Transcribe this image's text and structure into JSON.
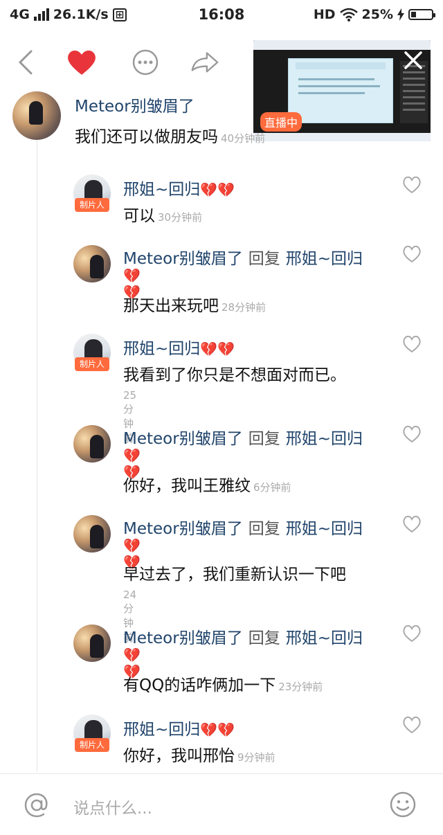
{
  "status_bar": {
    "network": "4G",
    "speed": "26.1K/s",
    "time": "16:08",
    "hd": "HD",
    "battery": "25%"
  },
  "top_nav": {
    "icons": [
      "back-icon",
      "heart-icon",
      "more-icon",
      "share-icon"
    ]
  },
  "pip": {
    "live_label": "直播中"
  },
  "main_comment": {
    "author": "Meteor别皱眉了",
    "text": "我们还可以做朋友吗",
    "time": "40分钟前"
  },
  "replies": [
    {
      "author": "邢姐~回归",
      "hearts": "💔💔",
      "badge": "制片人",
      "text": "可以",
      "time": "30分钟前"
    },
    {
      "author": "Meteor别皱眉了",
      "reply_word": "回复",
      "reply_to": "邢姐~回归",
      "hearts": "💔💔",
      "text": "那天出来玩吧",
      "time": "28分钟前"
    },
    {
      "author": "邢姐~回归",
      "hearts": "💔💔",
      "badge": "制片人",
      "text": "我看到了你只是不想面对而已。",
      "time": "25分钟前"
    },
    {
      "author": "Meteor别皱眉了",
      "reply_word": "回复",
      "reply_to": "邢姐~回归",
      "hearts": "💔💔",
      "text": "你好，我叫王雅纹",
      "time": "6分钟前"
    },
    {
      "author": "Meteor别皱眉了",
      "reply_word": "回复",
      "reply_to": "邢姐~回归",
      "hearts": "💔💔",
      "text": "早过去了，我们重新认识一下吧",
      "time": "24分钟前"
    },
    {
      "author": "Meteor别皱眉了",
      "reply_word": "回复",
      "reply_to": "邢姐~回归",
      "hearts": "💔💔",
      "text": "有QQ的话咋俩加一下",
      "time": "23分钟前"
    },
    {
      "author": "邢姐~回归",
      "hearts": "💔💔",
      "badge": "制片人",
      "text": "你好，我叫邢怡",
      "time": "9分钟前"
    }
  ],
  "bottom_bar": {
    "placeholder": "说点什么..."
  },
  "colors": {
    "name": "#20446b",
    "accent": "#ff6b3d",
    "heart": "#e8343a"
  }
}
